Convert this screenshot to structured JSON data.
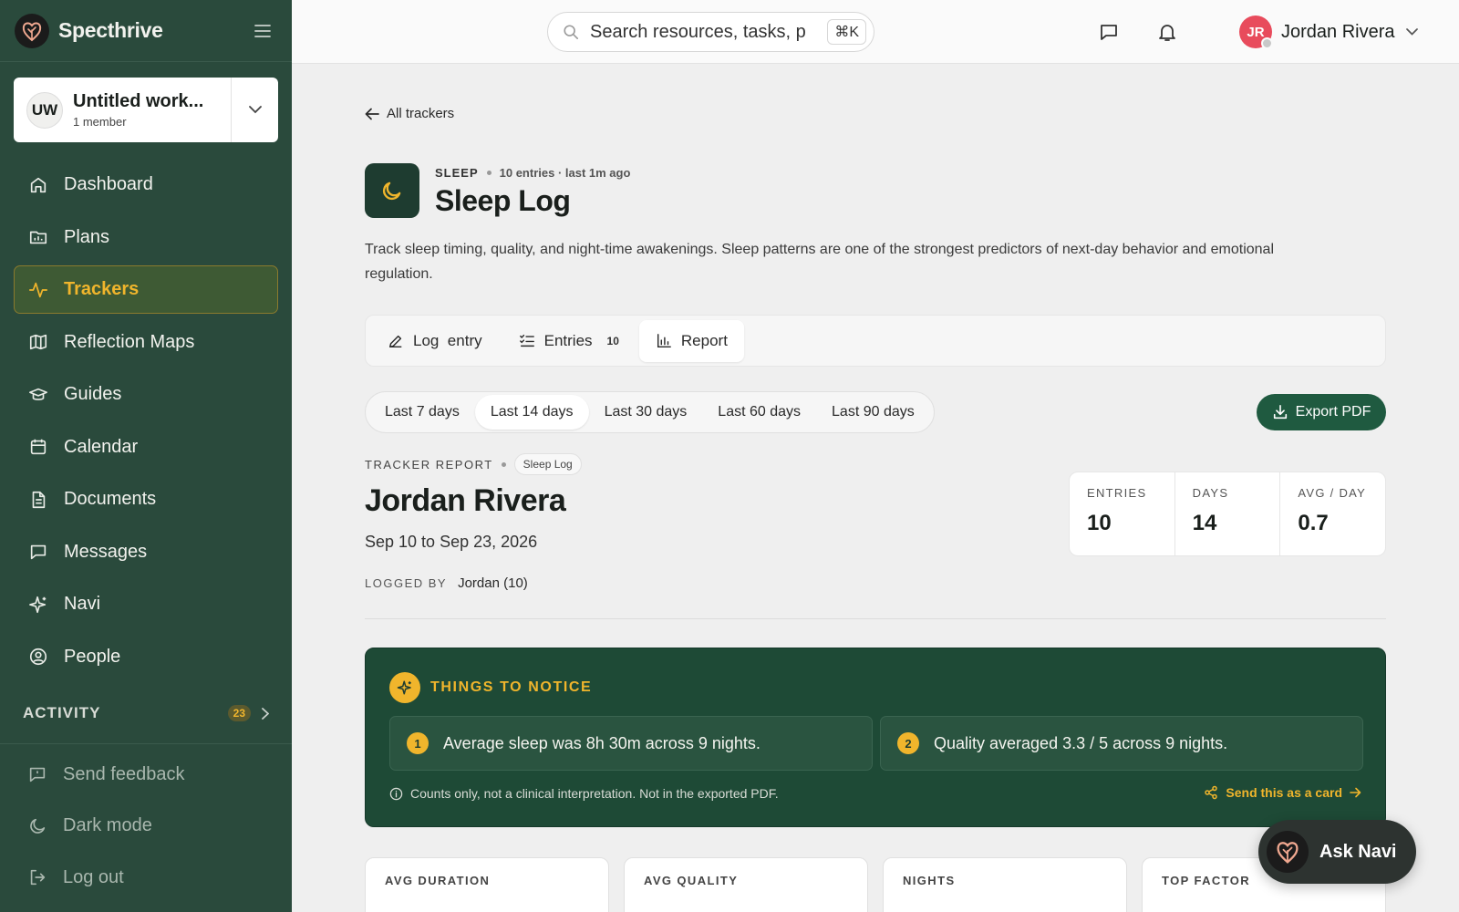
{
  "brand": {
    "name": "Specthrive"
  },
  "workspace": {
    "initials": "UW",
    "name": "Untitled work...",
    "members": "1 member"
  },
  "nav": [
    {
      "label": "Dashboard",
      "icon": "home-icon"
    },
    {
      "label": "Plans",
      "icon": "folder-chart-icon"
    },
    {
      "label": "Trackers",
      "icon": "activity-icon",
      "active": true
    },
    {
      "label": "Reflection Maps",
      "icon": "map-icon"
    },
    {
      "label": "Guides",
      "icon": "graduation-cap-icon"
    },
    {
      "label": "Calendar",
      "icon": "calendar-icon"
    },
    {
      "label": "Documents",
      "icon": "document-icon"
    },
    {
      "label": "Messages",
      "icon": "message-icon"
    },
    {
      "label": "Navi",
      "icon": "sparkle-icon"
    },
    {
      "label": "People",
      "icon": "user-circle-icon"
    }
  ],
  "activity": {
    "label": "ACTIVITY",
    "count": "23"
  },
  "footer": [
    {
      "label": "Send feedback",
      "icon": "feedback-icon"
    },
    {
      "label": "Dark mode",
      "icon": "moon-icon"
    },
    {
      "label": "Log out",
      "icon": "logout-icon"
    }
  ],
  "search": {
    "placeholder": "Search resources, tasks, p",
    "shortcut": "⌘K"
  },
  "user": {
    "initials": "JR",
    "name": "Jordan Rivera"
  },
  "tracker": {
    "back_label": "All trackers",
    "category": "SLEEP",
    "subtitle": "10 entries · last 1m ago",
    "title": "Sleep Log",
    "description": "Track sleep timing, quality, and night-time awakenings. Sleep patterns are one of the strongest predictors of next-day behavior and emotional regulation."
  },
  "tabs": [
    {
      "label": "Log  entry",
      "icon": "pencil-icon"
    },
    {
      "label": "Entries",
      "icon": "list-check-icon",
      "count": "10"
    },
    {
      "label": "Report",
      "icon": "bar-chart-icon",
      "active": true
    }
  ],
  "ranges": [
    {
      "label": "Last 7 days"
    },
    {
      "label": "Last 14 days",
      "active": true
    },
    {
      "label": "Last 30 days"
    },
    {
      "label": "Last 60 days"
    },
    {
      "label": "Last 90 days"
    }
  ],
  "export_label": "Export PDF",
  "report": {
    "kicker": "TRACKER REPORT",
    "pill": "Sleep Log",
    "name": "Jordan Rivera",
    "dates": "Sep 10 to Sep 23, 2026",
    "logged_by_label": "LOGGED BY",
    "logged_by_value": "Jordan (10)",
    "stats": [
      {
        "label": "ENTRIES",
        "value": "10"
      },
      {
        "label": "DAYS",
        "value": "14"
      },
      {
        "label": "AVG / DAY",
        "value": "0.7"
      }
    ]
  },
  "notice": {
    "title": "THINGS TO NOTICE",
    "items": [
      {
        "num": "1",
        "text": "Average sleep was 8h 30m across 9 nights."
      },
      {
        "num": "2",
        "text": "Quality averaged 3.3 / 5 across 9 nights."
      }
    ],
    "footnote": "Counts only, not a clinical interpretation. Not in the exported PDF.",
    "send_label": "Send this as a card"
  },
  "metrics": [
    {
      "label": "AVG DURATION"
    },
    {
      "label": "AVG QUALITY"
    },
    {
      "label": "NIGHTS"
    },
    {
      "label": "TOP FACTOR"
    }
  ],
  "ask_navi": "Ask Navi",
  "colors": {
    "sidebar": "#2a4a3c",
    "accent": "#f0b52c",
    "primary_button": "#1f5a40",
    "notice_bg": "#1e4a36",
    "avatar": "#e84b5c"
  }
}
